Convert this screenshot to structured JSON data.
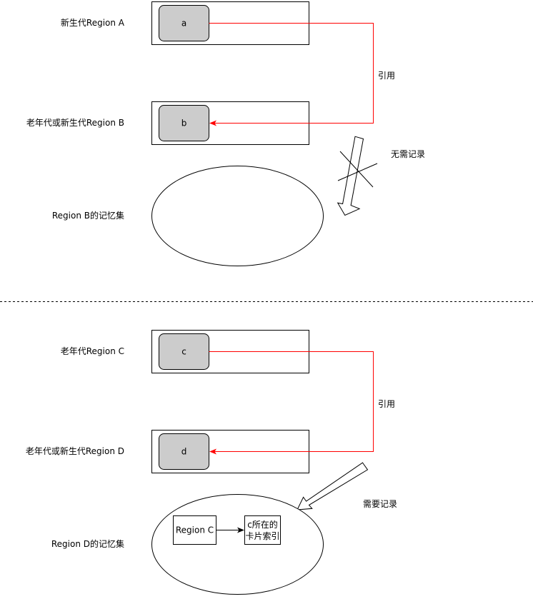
{
  "colors": {
    "background": "#ffffff",
    "object_fill": "#cccccc",
    "stroke": "#000000",
    "reference_line": "#ff0000"
  },
  "top": {
    "label_region_a": "新生代Region A",
    "label_region_b": "老年代或新生代Region B",
    "label_remembered_set": "Region B的记忆集",
    "object_a": "a",
    "object_b": "b",
    "reference_label": "引用",
    "no_record_label": "无需记录"
  },
  "bottom": {
    "label_region_c": "老年代Region C",
    "label_region_d": "老年代或新生代Region D",
    "label_remembered_set": "Region D的记忆集",
    "object_c": "c",
    "object_d": "d",
    "reference_label": "引用",
    "record_label": "需要记录",
    "entry_key": "Region C",
    "entry_value_line1": "c所在的",
    "entry_value_line2": "卡片索引"
  },
  "icons": [
    "cross-icon",
    "arrow-icon"
  ]
}
